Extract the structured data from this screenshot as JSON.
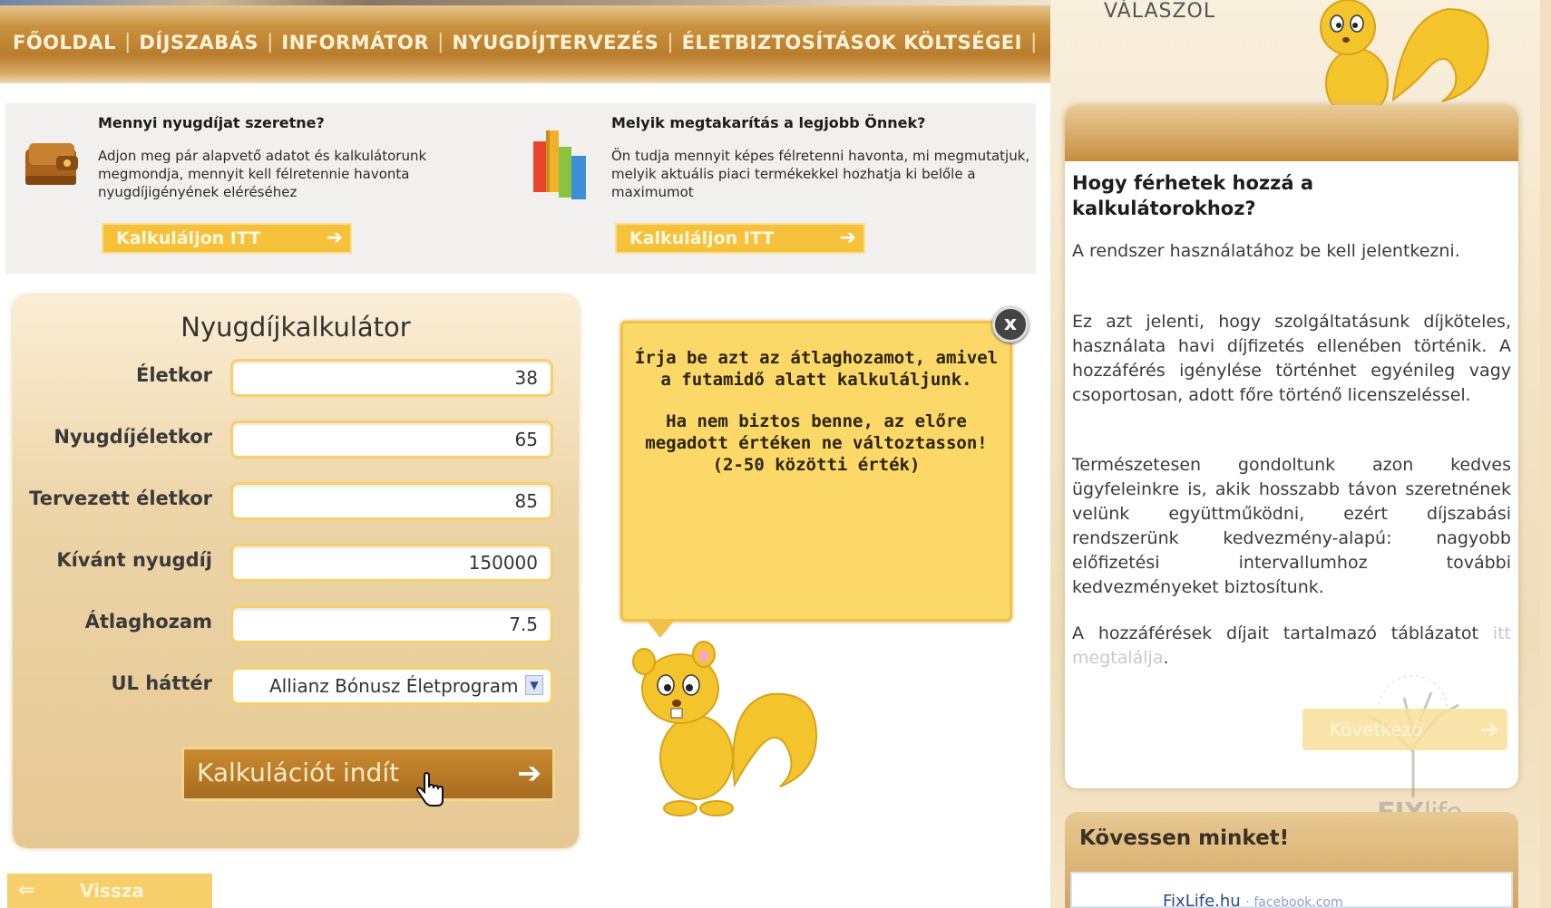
{
  "nav": {
    "items": [
      "FŐOLDAL",
      "DÍJSZABÁS",
      "INFORMÁTOR",
      "NYUGDÍJTERVEZÉS",
      "ÉLETBIZTOSÍTÁSOK KÖLTSÉGEI"
    ],
    "separator": "|"
  },
  "info": {
    "left": {
      "title": "Mennyi nyugdíjat szeretne?",
      "text": "Adjon meg pár alapvető adatot és kalkulátorunk megmondja, mennyit kell félretennie havonta nyugdíjigényének eléréséhez",
      "button": "Kalkuláljon ITT"
    },
    "right": {
      "title": "Melyik megtakarítás a legjobb Önnek?",
      "text": "Ön tudja mennyit képes félretenni havonta, mi megmutatjuk, melyik aktuális piaci termékekkel hozhatja ki belőle a maximumot",
      "button": "Kalkuláljon ITT"
    },
    "arrow": "➔"
  },
  "calculator": {
    "title": "Nyugdíjkalkulátor",
    "fields": [
      {
        "label": "Életkor",
        "value": "38"
      },
      {
        "label": "Nyugdíjéletkor",
        "value": "65"
      },
      {
        "label": "Tervezett életkor",
        "value": "85"
      },
      {
        "label": "Kívánt nyugdíj",
        "value": "150000"
      },
      {
        "label": "Átlaghozam",
        "value": "7.5"
      }
    ],
    "select": {
      "label": "UL háttér",
      "value": "Allianz Bónusz Életprogram",
      "dropdown_glyph": "▼"
    },
    "run_button": "Kalkulációt indít",
    "arrow": "➔"
  },
  "back_button": {
    "label": "Vissza",
    "arrow": "⇐"
  },
  "tooltip": {
    "line1": "Írja be azt az átlaghozamot, amivel",
    "line2": "a futamidő alatt kalkuláljunk.",
    "line3": "Ha nem biztos benne, az előre",
    "line4": "megadott értéken ne változtasson!",
    "line5": "(2-50 közötti érték)",
    "close": "x"
  },
  "sidebar": {
    "answer_title": "VÁLASZOL",
    "question": "Hogy férhetek hozzá a kalkulátorokhoz?",
    "p1": "A rendszer használatához be kell jelentkezni.",
    "p2": "Ez azt jelenti, hogy szolgáltatásunk díjköteles, használata havi díjfizetés ellenében történik. A hozzáférés igénylése történhet egyénileg vagy csoportosan, adott főre történő licenszeléssel.",
    "p3": "Természetesen gondoltunk azon kedves ügyfeleinkre is, akik hosszabb távon szeretnének velünk együttműködni, ezért díjszabási rendszerünk kedvezmény-alapú: nagyobb előfizetési intervallumhoz további kedvezményeket biztosítunk.",
    "p4_prefix": "A hozzáférések díjait tartalmazó táblázatot ",
    "p4_link": "itt megtalálja",
    "p4_suffix": ".",
    "next_button": "Következő",
    "follow_title": "Kövessen minket!",
    "follow_text": "FixLife.hu",
    "follow_suffix": "· facebook.com",
    "logo_fix": "FIX",
    "logo_life": "life"
  },
  "colors": {
    "accent": "#f6c13b",
    "brown": "#b97d2e",
    "tooltip": "#fbd867",
    "squirrel": "#f4c42c"
  }
}
